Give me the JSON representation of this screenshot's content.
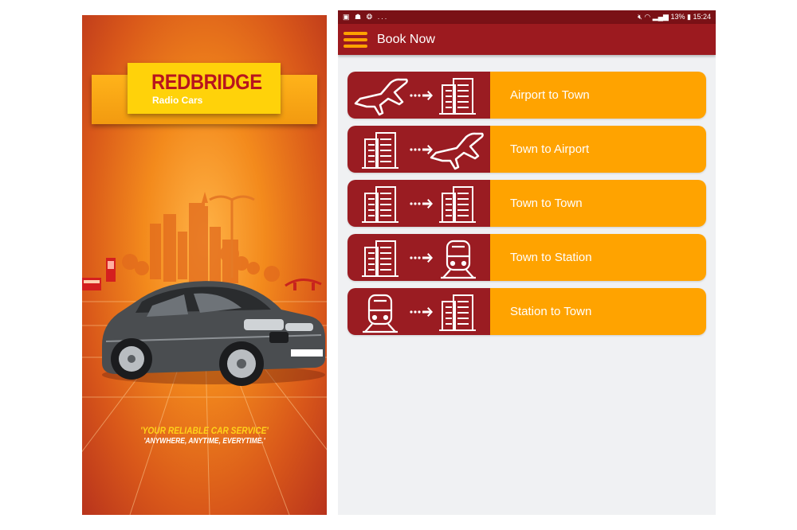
{
  "splash": {
    "brand_name": "REDBRIDGE",
    "brand_sub": "Radio Cars",
    "plate_text": "",
    "tagline_1": "'YOUR RELIABLE CAR SERVICE'",
    "tagline_2": "'ANYWHERE, ANYTIME, EVERYTIME.'"
  },
  "status_bar": {
    "left_icons": [
      "image-icon",
      "bug-icon",
      "chat-icon"
    ],
    "more": "...",
    "battery": "13%",
    "time": "15:24"
  },
  "app_bar": {
    "title": "Book Now",
    "menu_icon": "hamburger-menu-icon"
  },
  "routes": [
    {
      "label": "Airport to Town",
      "from_icon": "airplane-icon",
      "to_icon": "buildings-icon"
    },
    {
      "label": "Town to Airport",
      "from_icon": "buildings-icon",
      "to_icon": "airplane-icon"
    },
    {
      "label": "Town to Town",
      "from_icon": "buildings-icon",
      "to_icon": "buildings-icon"
    },
    {
      "label": "Town to Station",
      "from_icon": "buildings-icon",
      "to_icon": "train-icon"
    },
    {
      "label": "Station to Town",
      "from_icon": "train-icon",
      "to_icon": "buildings-icon"
    }
  ],
  "colors": {
    "primary_dark": "#7a1116",
    "primary": "#9c1a1f",
    "icon_panel": "#9a1c22",
    "accent": "#ffa300",
    "background": "#f0f1f3",
    "menu_icon": "#ffa200"
  }
}
